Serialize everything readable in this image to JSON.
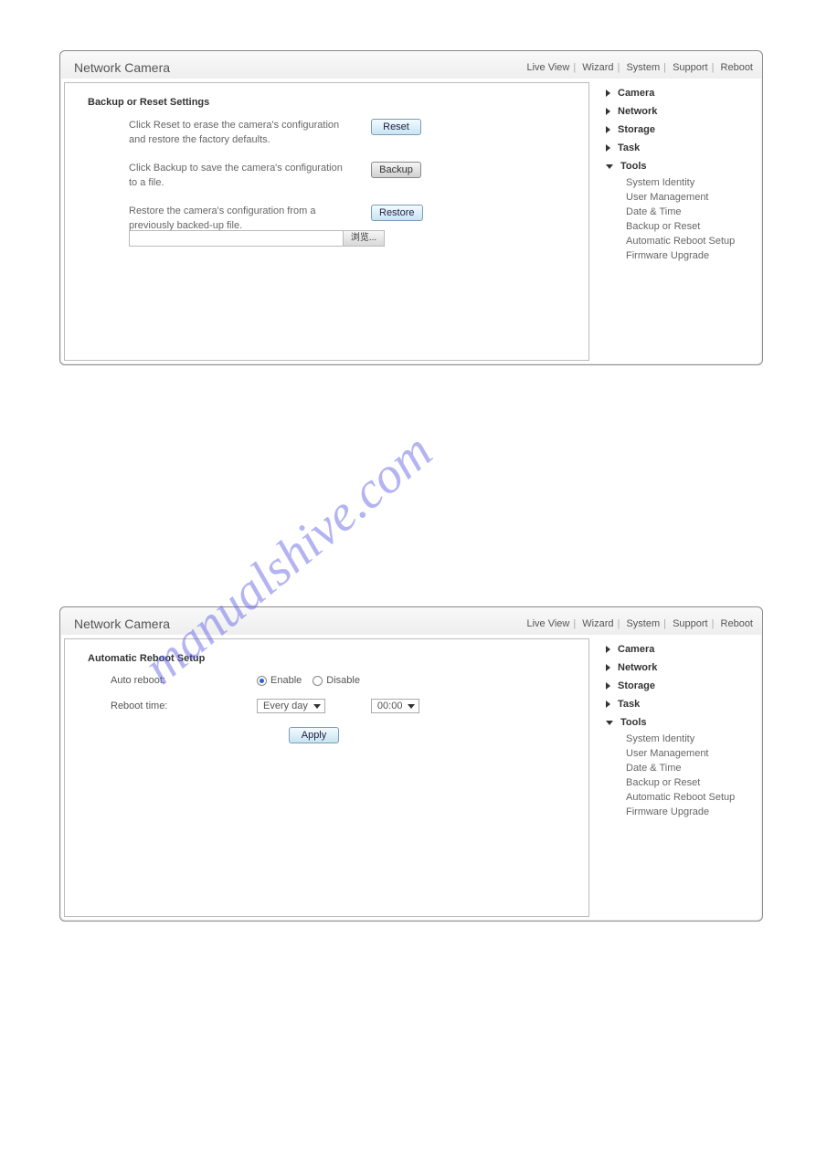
{
  "app_title": "Network Camera",
  "top_nav": [
    "Live View",
    "Wizard",
    "System",
    "Support",
    "Reboot"
  ],
  "panel1": {
    "title": "Backup or Reset Settings",
    "rows": [
      {
        "text": "Click Reset to erase the camera's configuration and restore the factory defaults.",
        "button": "Reset",
        "style": "blue"
      },
      {
        "text": "Click Backup to save the camera's configuration to a file.",
        "button": "Backup",
        "style": "gray"
      },
      {
        "text": "Restore the camera's configuration from a previously backed-up file.",
        "button": "Restore",
        "style": "blue"
      }
    ],
    "browse_label": "浏览..."
  },
  "panel2": {
    "title": "Automatic Reboot Setup",
    "auto_reboot_label": "Auto reboot:",
    "enable_label": "Enable",
    "disable_label": "Disable",
    "reboot_time_label": "Reboot time:",
    "freq_value": "Every day",
    "time_value": "00:00",
    "apply_label": "Apply"
  },
  "sidebar": {
    "groups": [
      {
        "label": "Camera",
        "open": false
      },
      {
        "label": "Network",
        "open": false
      },
      {
        "label": "Storage",
        "open": false
      },
      {
        "label": "Task",
        "open": false
      },
      {
        "label": "Tools",
        "open": true,
        "subs": [
          "System Identity",
          "User Management",
          "Date & Time",
          "Backup or Reset",
          "Automatic Reboot Setup",
          "Firmware Upgrade"
        ]
      }
    ]
  },
  "watermark": "manualshive.com"
}
